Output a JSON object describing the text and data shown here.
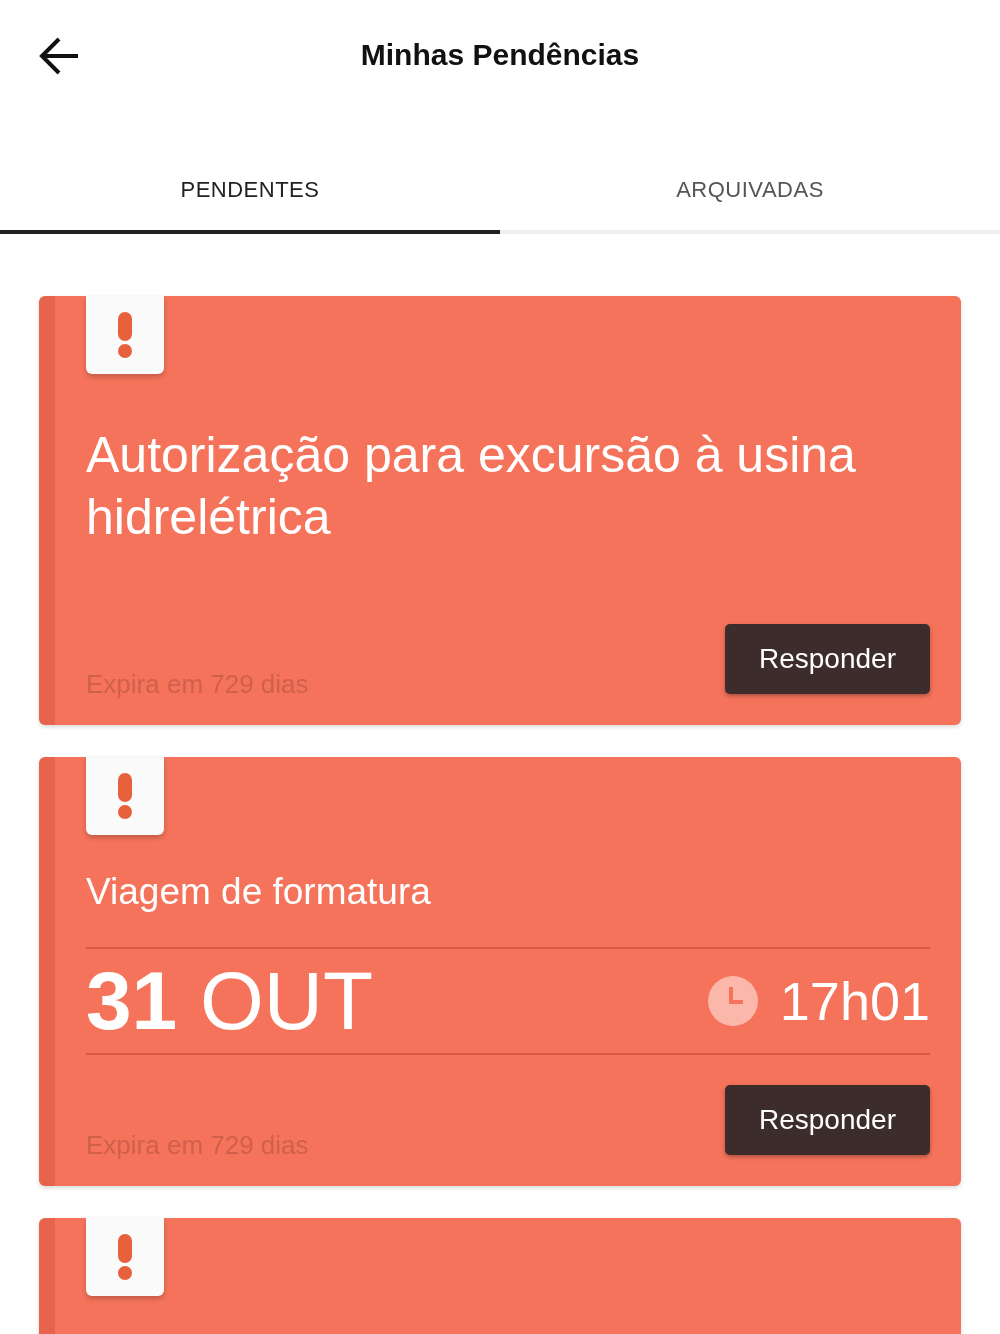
{
  "header": {
    "title": "Minhas Pendências"
  },
  "tabs": [
    {
      "label": "PENDENTES",
      "selected": true
    },
    {
      "label": "ARQUIVADAS",
      "selected": false
    }
  ],
  "cards": [
    {
      "kind": "plain",
      "title": "Autorização para excursão à usina hidrelétrica",
      "expiry": "Expira em 729 dias",
      "button": "Responder"
    },
    {
      "kind": "event",
      "title": "Viagem de formatura",
      "day": "31",
      "month": "OUT",
      "time": "17h01",
      "expiry": "Expira em 729 dias",
      "button": "Responder"
    },
    {
      "kind": "partial"
    }
  ]
}
